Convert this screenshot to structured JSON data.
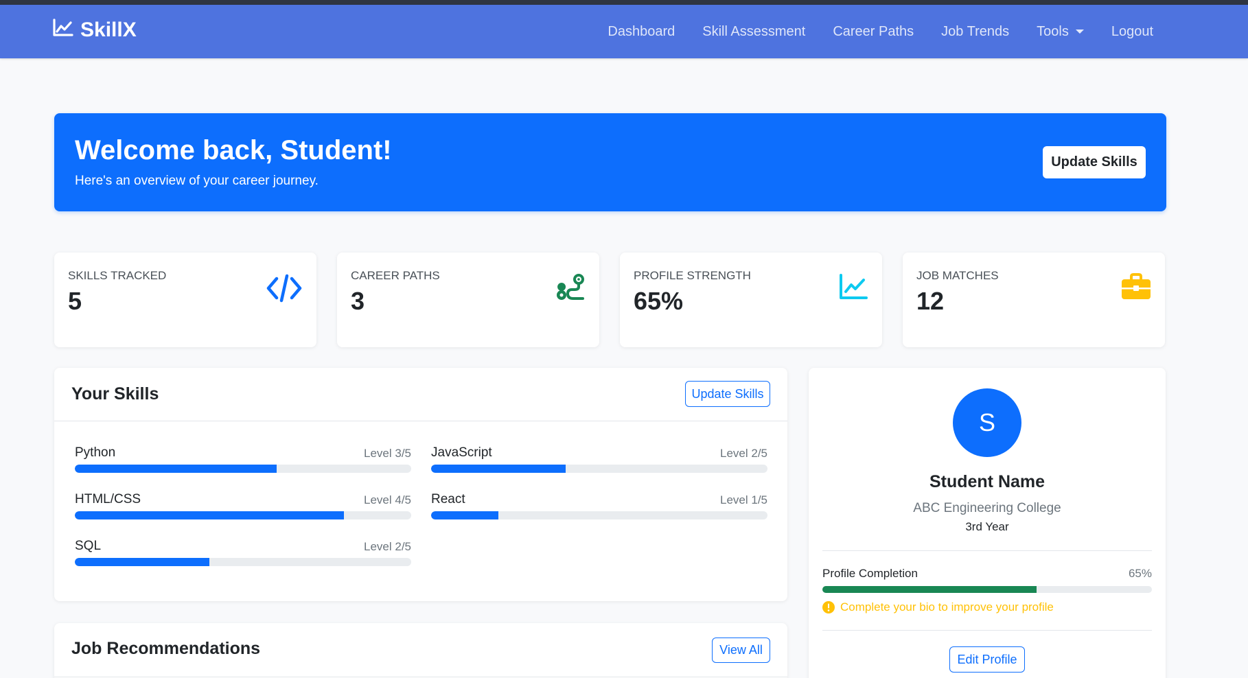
{
  "nav": {
    "brand": "SkillX",
    "links": [
      "Dashboard",
      "Skill Assessment",
      "Career Paths",
      "Job Trends",
      "Tools",
      "Logout"
    ]
  },
  "hero": {
    "title": "Welcome back, Student!",
    "subtitle": "Here's an overview of your career journey.",
    "button": "Update Skills"
  },
  "stats": [
    {
      "label": "Skills Tracked",
      "value": "5",
      "icon": "code-icon",
      "color": "#0d6efd"
    },
    {
      "label": "Career Paths",
      "value": "3",
      "icon": "route-icon",
      "color": "#198754"
    },
    {
      "label": "Profile Strength",
      "value": "65%",
      "icon": "chart-line-icon",
      "color": "#0dcaf0"
    },
    {
      "label": "Job Matches",
      "value": "12",
      "icon": "briefcase-icon",
      "color": "#ffc107"
    }
  ],
  "skills_card": {
    "title": "Your Skills",
    "button": "Update Skills",
    "skills": [
      {
        "name": "Python",
        "level": "Level 3/5",
        "progress": 0.6
      },
      {
        "name": "JavaScript",
        "level": "Level 2/5",
        "progress": 0.4
      },
      {
        "name": "HTML/CSS",
        "level": "Level 4/5",
        "progress": 0.8
      },
      {
        "name": "React",
        "level": "Level 1/5",
        "progress": 0.2
      },
      {
        "name": "SQL",
        "level": "Level 2/5",
        "progress": 0.4
      }
    ]
  },
  "jobs_card": {
    "title": "Job Recommendations",
    "button": "View All"
  },
  "profile": {
    "initial": "S",
    "name": "Student Name",
    "college": "ABC Engineering College",
    "year": "3rd Year",
    "completion_label": "Profile Completion",
    "completion_value": "65%",
    "completion": 0.65,
    "hint": "Complete your bio to improve your profile",
    "button": "Edit Profile"
  },
  "colors": {
    "navbar": "#4e73df",
    "primary": "#0d6efd",
    "success": "#198754",
    "warning": "#ffc107"
  }
}
